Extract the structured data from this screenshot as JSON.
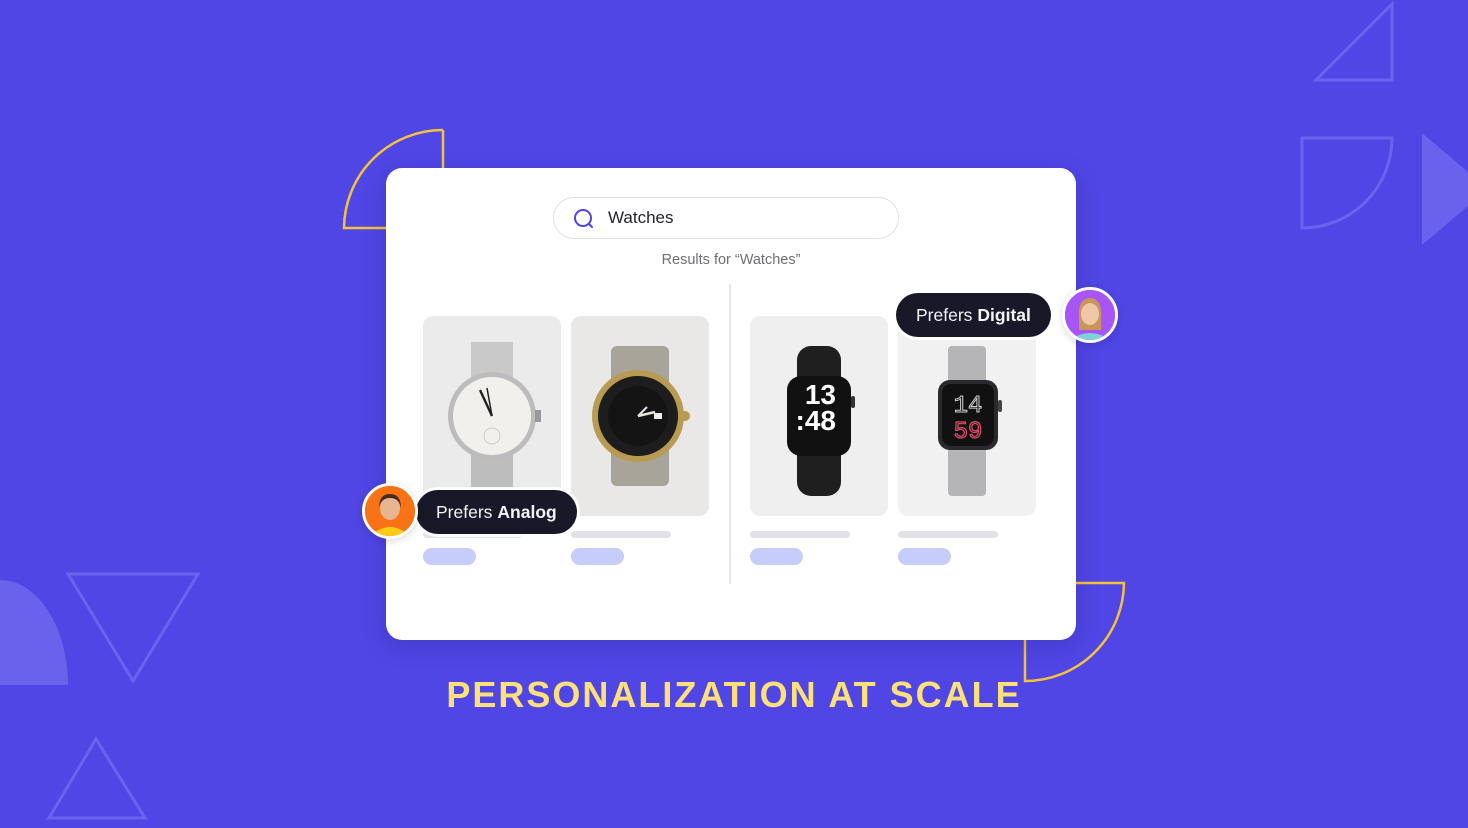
{
  "colors": {
    "background": "#4f46e5",
    "accent_yellow": "#fbbf24",
    "headline": "#fde07a",
    "tag_bg": "#181828",
    "price_pill": "#c7cdfb",
    "card_bg": "#ffffff"
  },
  "search": {
    "icon": "search-icon",
    "value": "Watches"
  },
  "results": {
    "caption": "Results for “Watches”"
  },
  "groups": [
    {
      "tag_prefix": "Prefers",
      "tag_emphasis": "Analog",
      "avatar": "avatar-woman-orange",
      "products": [
        {
          "name": "vintage-silver-analog-watch",
          "time_display": ""
        },
        {
          "name": "black-gold-dive-watch",
          "time_display": ""
        }
      ]
    },
    {
      "tag_prefix": "Prefers",
      "tag_emphasis": "Digital",
      "avatar": "avatar-woman-purple",
      "products": [
        {
          "name": "black-smartwatch",
          "time_display": "13\n:48"
        },
        {
          "name": "silver-loop-smartwatch",
          "time_display": "14\n59"
        }
      ]
    }
  ],
  "headline": "PERSONALIZATION AT SCALE"
}
